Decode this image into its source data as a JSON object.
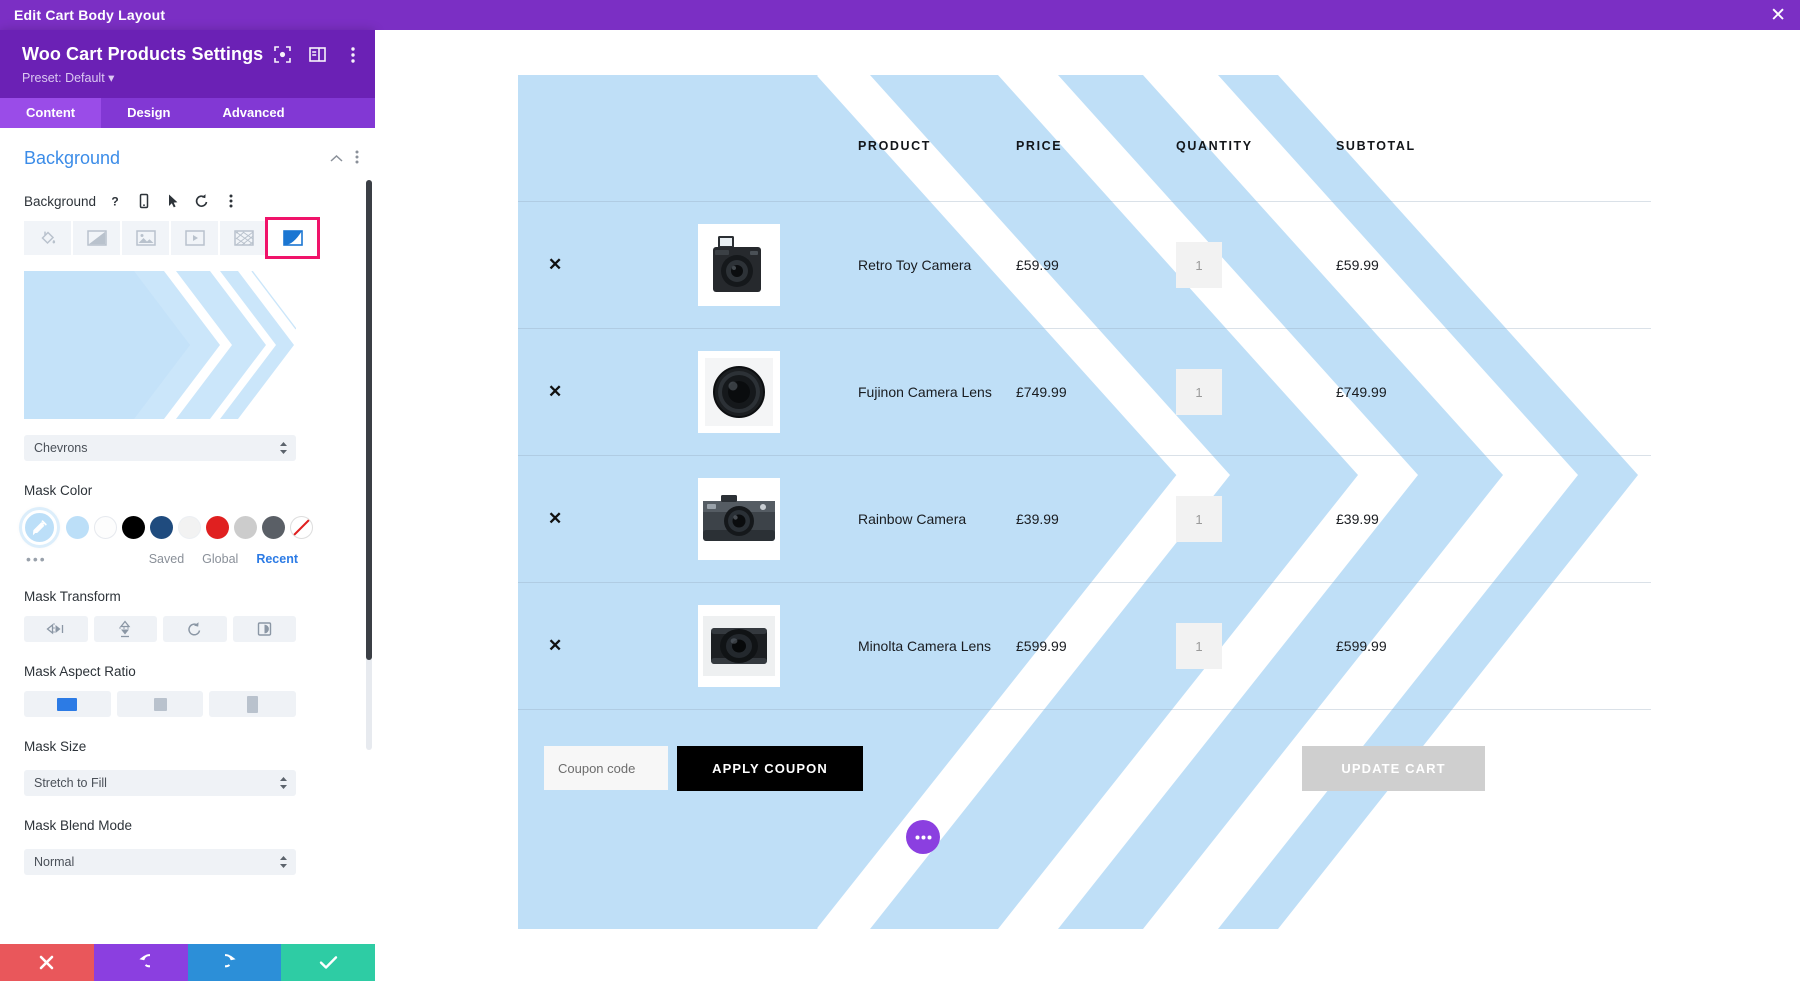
{
  "titlebar": {
    "text": "Edit Cart Body Layout",
    "close_icon": "close-icon"
  },
  "panel": {
    "title": "Woo Cart Products Settings",
    "preset": "Preset: Default",
    "header_icons": [
      "focus-icon",
      "layout-icon",
      "vertical-dots-icon"
    ],
    "tabs": [
      {
        "label": "Content",
        "active": true
      },
      {
        "label": "Design",
        "active": false
      },
      {
        "label": "Advanced",
        "active": false
      }
    ],
    "section": {
      "title": "Background",
      "collapse_icon": "chevron-up-icon",
      "more_icon": "vertical-dots-icon"
    },
    "background_field": {
      "label": "Background",
      "icons": [
        "help-icon",
        "responsive-icon",
        "hover-icon",
        "reset-icon",
        "vertical-dots-icon"
      ],
      "types": [
        {
          "name": "background-color",
          "selected": false
        },
        {
          "name": "background-gradient",
          "selected": false
        },
        {
          "name": "background-image",
          "selected": false
        },
        {
          "name": "background-video",
          "selected": false
        },
        {
          "name": "background-pattern",
          "selected": false
        },
        {
          "name": "background-mask",
          "selected": true
        }
      ],
      "selected_outline_color": "#F0136A"
    },
    "mask_style": {
      "value": "Chevrons"
    },
    "mask_color": {
      "label": "Mask Color",
      "picker_icon": "eyedropper-icon",
      "swatches": [
        {
          "name": "light-blue",
          "color": "#BCDFF8"
        },
        {
          "name": "white",
          "color": "#FDFDFD"
        },
        {
          "name": "black",
          "color": "#000000"
        },
        {
          "name": "navy",
          "color": "#1F4B7E"
        },
        {
          "name": "off-white",
          "color": "#F2F2F2"
        },
        {
          "name": "red",
          "color": "#E02020"
        },
        {
          "name": "light-gray",
          "color": "#CCCCCC"
        },
        {
          "name": "dark-gray",
          "color": "#5A5F66"
        },
        {
          "name": "transparent",
          "color": "transparent"
        }
      ],
      "more_dots": "•••",
      "tabs": [
        {
          "label": "Saved",
          "active": false
        },
        {
          "label": "Global",
          "active": false
        },
        {
          "label": "Recent",
          "active": true
        }
      ]
    },
    "mask_transform": {
      "label": "Mask Transform",
      "buttons": [
        {
          "name": "flip-horizontal-icon"
        },
        {
          "name": "flip-vertical-icon"
        },
        {
          "name": "rotate-icon"
        },
        {
          "name": "invert-icon"
        }
      ]
    },
    "mask_aspect_ratio": {
      "label": "Mask Aspect Ratio",
      "buttons": [
        {
          "name": "aspect-landscape",
          "active": true
        },
        {
          "name": "aspect-square",
          "active": false
        },
        {
          "name": "aspect-portrait",
          "active": false
        }
      ],
      "active_color": "#2C7BE5"
    },
    "mask_size": {
      "label": "Mask Size",
      "value": "Stretch to Fill"
    },
    "mask_blend_mode": {
      "label": "Mask Blend Mode",
      "value": "Normal"
    },
    "actions": [
      {
        "name": "cancel-button",
        "icon": "x-icon",
        "color": "#E9575B"
      },
      {
        "name": "undo-button",
        "icon": "undo-icon",
        "color": "#8B3FE0"
      },
      {
        "name": "redo-button",
        "icon": "redo-icon",
        "color": "#2C8FD8"
      },
      {
        "name": "save-button",
        "icon": "check-icon",
        "color": "#2ECCA4"
      }
    ]
  },
  "cart": {
    "mask_color": "#BFDFF7",
    "columns": [
      "PRODUCT",
      "PRICE",
      "QUANTITY",
      "SUBTOTAL"
    ],
    "rows": [
      {
        "remove": "✕",
        "thumb": "retro-toy-camera",
        "name": "Retro Toy Camera",
        "price": "£59.99",
        "qty": "1",
        "subtotal": "£59.99"
      },
      {
        "remove": "✕",
        "thumb": "fujinon-camera-lens",
        "name": "Fujinon Camera Lens",
        "price": "£749.99",
        "qty": "1",
        "subtotal": "£749.99"
      },
      {
        "remove": "✕",
        "thumb": "rainbow-camera",
        "name": "Rainbow Camera",
        "price": "£39.99",
        "qty": "1",
        "subtotal": "£39.99"
      },
      {
        "remove": "✕",
        "thumb": "minolta-camera-lens",
        "name": "Minolta Camera Lens",
        "price": "£599.99",
        "qty": "1",
        "subtotal": "£599.99"
      }
    ],
    "coupon": {
      "placeholder": "Coupon code",
      "value": "",
      "apply_label": "APPLY COUPON",
      "update_label": "UPDATE CART"
    },
    "fab": {
      "icon": "ellipsis-icon",
      "label": "•••"
    }
  }
}
